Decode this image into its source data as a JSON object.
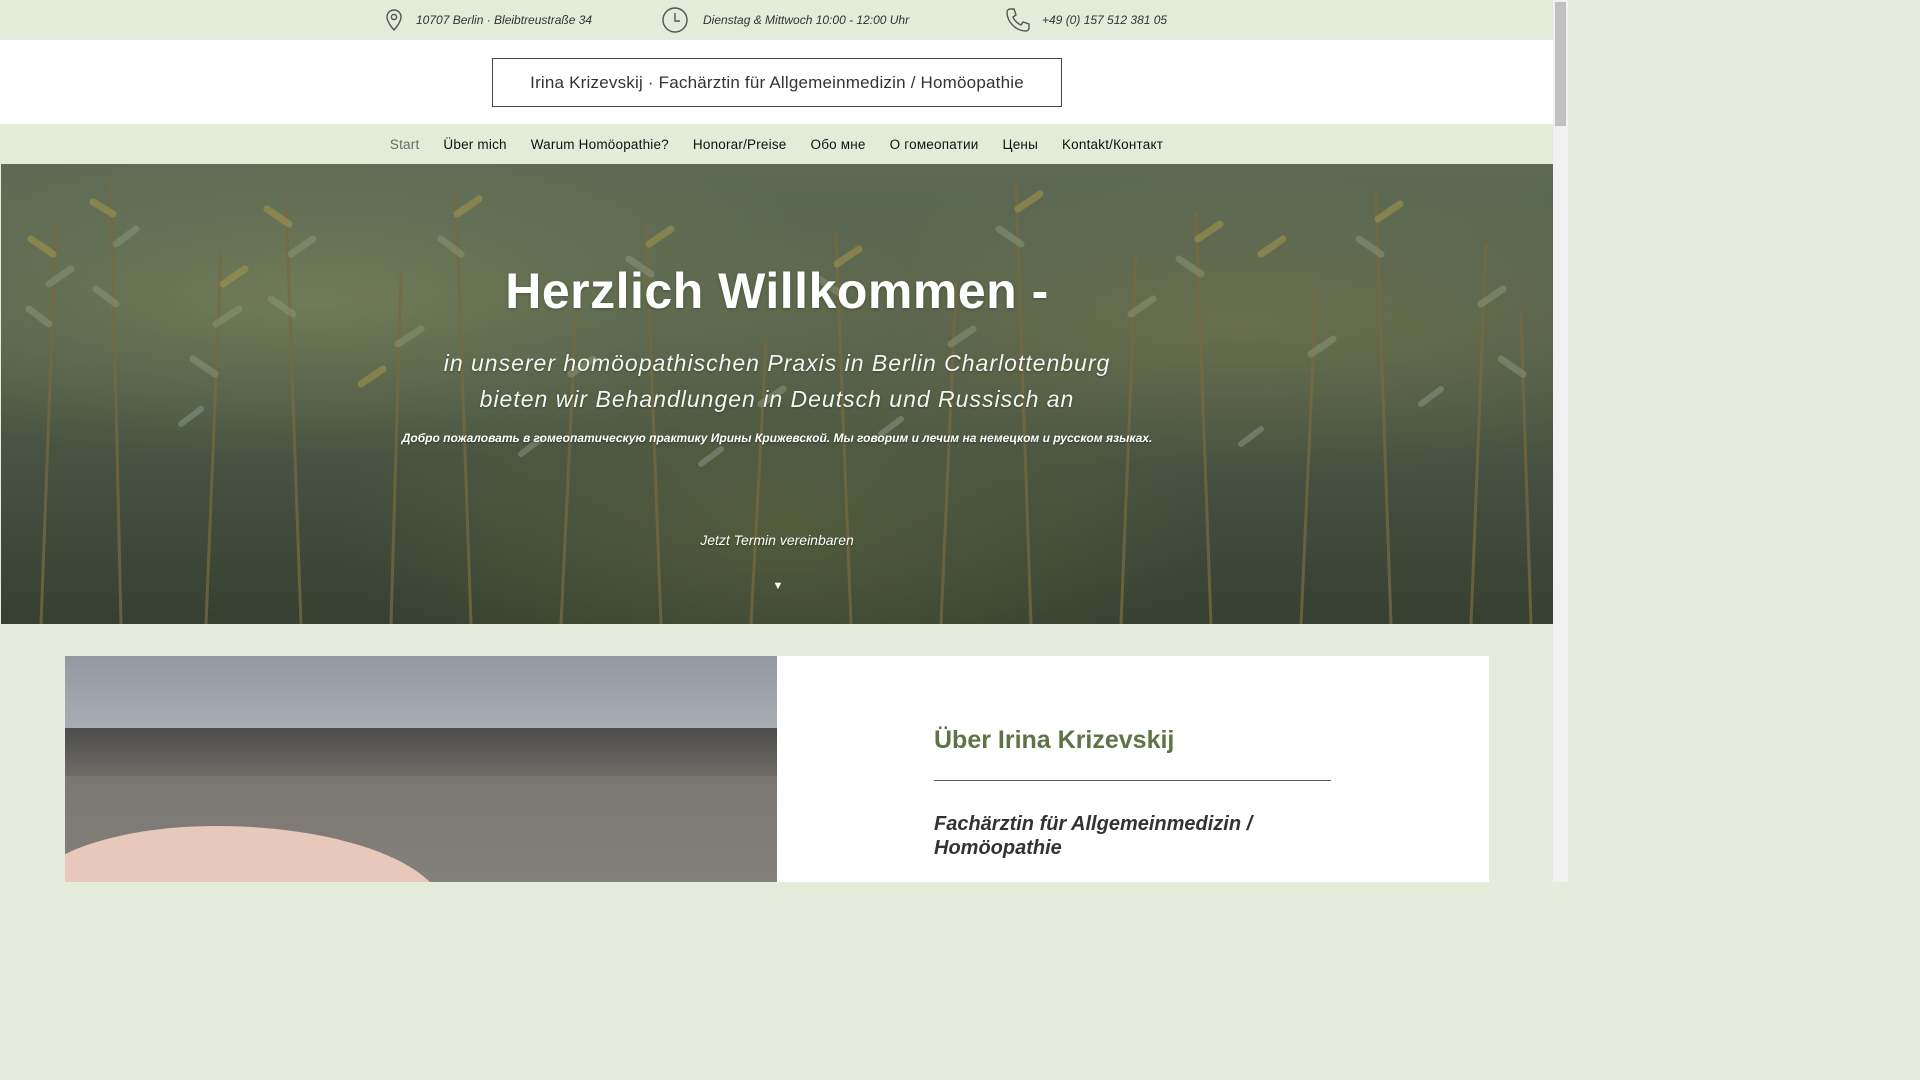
{
  "topbar": {
    "address": "10707 Berlin · Bleibtreustraße 34",
    "hours": "Dienstag & Mittwoch 10:00 - 12:00 Uhr",
    "phone": "+49  (0) 157 512 381 05"
  },
  "header": {
    "site_title": "Irina Krizevskij · Fachärztin für Allgemeinmedizin / Homöopathie"
  },
  "nav": {
    "items": [
      {
        "label": "Start",
        "active": true
      },
      {
        "label": "Über mich"
      },
      {
        "label": "Warum Homöopathie?"
      },
      {
        "label": "Honorar/Preise"
      },
      {
        "label": "Обо мне"
      },
      {
        "label": "О гомеопатии"
      },
      {
        "label": "Цены"
      },
      {
        "label": "Kontakt/Контакт"
      }
    ]
  },
  "hero": {
    "title": "Herzlich Willkommen -",
    "subtitle_line1": "in unserer homöopathischen Praxis in Berlin Charlottenburg",
    "subtitle_line2": "bieten wir Behandlungen in Deutsch und Russisch an",
    "russian_text": "Добро пожаловать в гомеопатическую практику Ирины Крижевской. Мы говорим и лечим на немецком и русском языках.",
    "cta": "Jetzt Termin vereinbaren",
    "arrow": "▼"
  },
  "about": {
    "heading": "Über Irina Krizevskij",
    "subheading": "Fachärztin für Allgemeinmedizin / Homöopathie"
  },
  "colors": {
    "accent_green": "#5e7447",
    "bar_green": "#e3ebd9"
  }
}
